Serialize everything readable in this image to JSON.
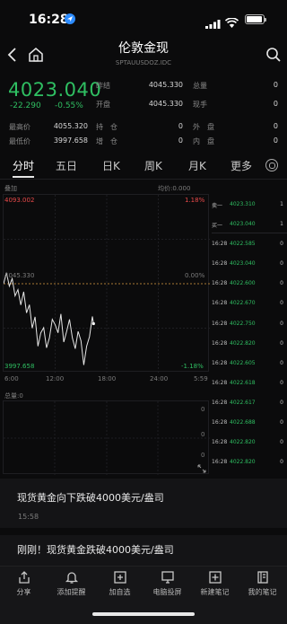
{
  "status_bar": {
    "time": "16:28"
  },
  "nav": {
    "title": "伦敦金现",
    "subtitle": "SPTAUUSDOZ.IDC"
  },
  "quote": {
    "price": "4023.040",
    "change": "-22.290",
    "change_pct": "-0.55%",
    "fields": [
      {
        "label": "昨结",
        "value": "4045.330"
      },
      {
        "label": "总量",
        "value": "0"
      },
      {
        "label": "开盘",
        "value": "4045.330"
      },
      {
        "label": "现手",
        "value": "0"
      },
      {
        "label": "最高价",
        "value": "4055.320"
      },
      {
        "label": "持　仓",
        "value": "0"
      },
      {
        "label": "外　盘",
        "value": "0"
      },
      {
        "label": "最低价",
        "value": "3997.658"
      },
      {
        "label": "增　仓",
        "value": "0"
      },
      {
        "label": "内　盘",
        "value": "0"
      }
    ]
  },
  "tabs": [
    "分时",
    "五日",
    "日K",
    "周K",
    "月K",
    "更多"
  ],
  "chart": {
    "legend_left": "叠加",
    "legend_right": "均价:0.000",
    "top_price": "4093.002",
    "top_pct": "1.18%",
    "mid_price": "4045.330",
    "mid_pct": "0.00%",
    "bottom_price": "3997.658",
    "bottom_pct": "-1.18%",
    "x_ticks": [
      "6:00",
      "12:00",
      "18:00",
      "24:00",
      "5:59"
    ],
    "volume_label": "总量:0",
    "vol_top": "0",
    "vol_mid": "0",
    "vol_bot": "0"
  },
  "chart_data": {
    "type": "line",
    "x": [
      "6:00",
      "6:20",
      "6:40",
      "7:00",
      "7:20",
      "7:40",
      "8:00",
      "8:20",
      "8:40",
      "9:00",
      "9:20",
      "9:40",
      "10:00",
      "10:20",
      "10:40",
      "11:00",
      "11:20",
      "11:40",
      "12:00",
      "12:20",
      "12:40",
      "13:00",
      "13:20",
      "13:40",
      "14:00",
      "14:20",
      "14:40",
      "15:00",
      "15:20",
      "15:40",
      "16:00",
      "16:20",
      "16:28"
    ],
    "values": [
      4045.3,
      4051.5,
      4044.0,
      4048.2,
      4038.5,
      4042.0,
      4033.5,
      4040.8,
      4029.0,
      4033.6,
      4020.5,
      4026.8,
      4010.4,
      4017.9,
      4020.8,
      4009.5,
      4015.0,
      4025.4,
      4022.4,
      4017.9,
      4028.4,
      4012.7,
      4018.7,
      4025.4,
      4015.0,
      4009.0,
      4018.7,
      4013.4,
      3999.9,
      4010.4,
      4015.7,
      4027.0,
      4023.0
    ],
    "xlim": [
      "6:00",
      "5:59"
    ],
    "ylim": [
      3997.658,
      4093.002
    ],
    "baseline": 4045.33,
    "ylabel_left": [
      "4093.002",
      "4045.330",
      "3997.658"
    ],
    "ylabel_right": [
      "1.18%",
      "0.00%",
      "-1.18%"
    ],
    "grid": true
  },
  "depth": [
    {
      "t": "卖一",
      "p": "4023.310",
      "q": "1"
    },
    {
      "t": "买一",
      "p": "4023.040",
      "q": "1"
    },
    {
      "t": "16:28",
      "p": "4022.585",
      "q": "0"
    },
    {
      "t": "16:28",
      "p": "4023.040",
      "q": "0"
    },
    {
      "t": "16:28",
      "p": "4022.600",
      "q": "0"
    },
    {
      "t": "16:28",
      "p": "4022.670",
      "q": "0"
    },
    {
      "t": "16:28",
      "p": "4022.750",
      "q": "0"
    },
    {
      "t": "16:28",
      "p": "4022.820",
      "q": "0"
    },
    {
      "t": "16:28",
      "p": "4022.605",
      "q": "0"
    },
    {
      "t": "16:28",
      "p": "4022.618",
      "q": "0"
    },
    {
      "t": "16:28",
      "p": "4022.617",
      "q": "0"
    },
    {
      "t": "16:28",
      "p": "4022.688",
      "q": "0"
    },
    {
      "t": "16:28",
      "p": "4022.820",
      "q": "0"
    },
    {
      "t": "16:28",
      "p": "4022.820",
      "q": "0"
    }
  ],
  "news": [
    {
      "title": "现货黄金向下跌破4000美元/盎司",
      "time": "15:58"
    },
    {
      "title": "刚刚！现货黄金跌破4000美元/盎司"
    }
  ],
  "bottom_bar": [
    "分享",
    "添加提醒",
    "加自选",
    "电脑投屏",
    "新建笔记",
    "我的笔记"
  ],
  "colors": {
    "up": "#e84a4a",
    "down": "#2fbf62",
    "line": "#e6e6e6",
    "baseline": "#e0a040"
  }
}
